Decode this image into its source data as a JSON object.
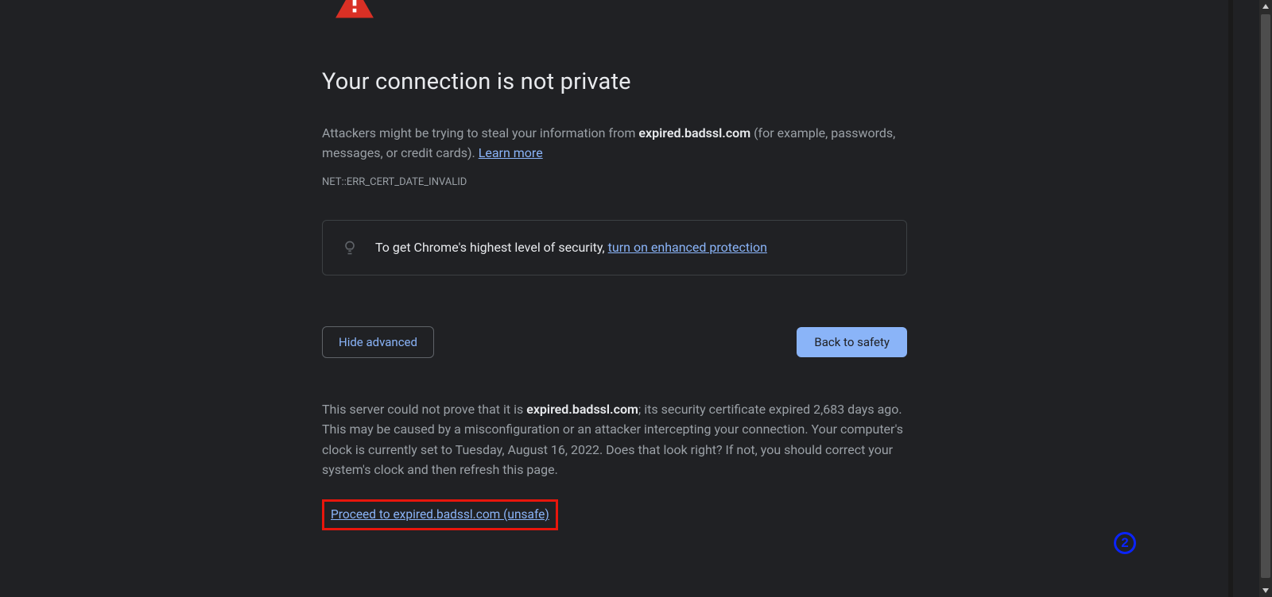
{
  "heading": "Your connection is not private",
  "body_prefix": "Attackers might be trying to steal your information from ",
  "hostname": "expired.badssl.com",
  "body_suffix": " (for example, passwords, messages, or credit cards). ",
  "learn_more": "Learn more",
  "error_code": "NET::ERR_CERT_DATE_INVALID",
  "tip_prefix": "To get Chrome's highest level of security, ",
  "tip_link": "turn on enhanced protection",
  "hide_advanced": "Hide advanced",
  "back_to_safety": "Back to safety",
  "advanced_prefix": "This server could not prove that it is ",
  "advanced_hostname": "expired.badssl.com",
  "advanced_suffix": "; its security certificate expired 2,683 days ago. This may be caused by a misconfiguration or an attacker intercepting your connection. Your computer's clock is currently set to Tuesday, August 16, 2022. Does that look right? If not, you should correct your system's clock and then refresh this page.",
  "proceed_link": "Proceed to expired.badssl.com (unsafe)",
  "badge_number": "2"
}
